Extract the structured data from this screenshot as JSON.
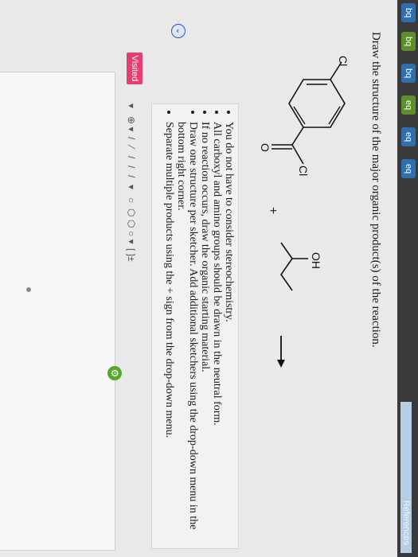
{
  "tabs": [
    {
      "label": "bq"
    },
    {
      "label": "bq"
    },
    {
      "label": "bq"
    },
    {
      "label": "eq"
    },
    {
      "label": "eq"
    },
    {
      "label": "eq"
    }
  ],
  "references_label": "References",
  "question": "Draw the structure of the major organic product(s) of the reaction.",
  "scheme": {
    "atom_cl_top": "Cl",
    "atom_oh": "OH",
    "atom_o": "O",
    "atom_cl": "Cl",
    "plus": "+",
    "arrow": "→"
  },
  "instructions": [
    "You do not have to consider stereochemistry.",
    "All carboxyl and amino groups should be drawn in the neutral form.",
    "If no reaction occurs, draw the organic starting material.",
    "Draw one structure per sketcher. Add additional sketchers using the drop-down menu in the bottom right corner.",
    "Separate multiple products using the + sign from the drop-down menu."
  ],
  "toolbar": {
    "tools": [
      "▾",
      "⊕ ▾",
      "/",
      "⁄",
      "/",
      "/",
      "/",
      "▾",
      "○",
      "⬡",
      "⬡",
      "○ ▾",
      "[ ]±"
    ]
  },
  "visited_label": "Visited"
}
